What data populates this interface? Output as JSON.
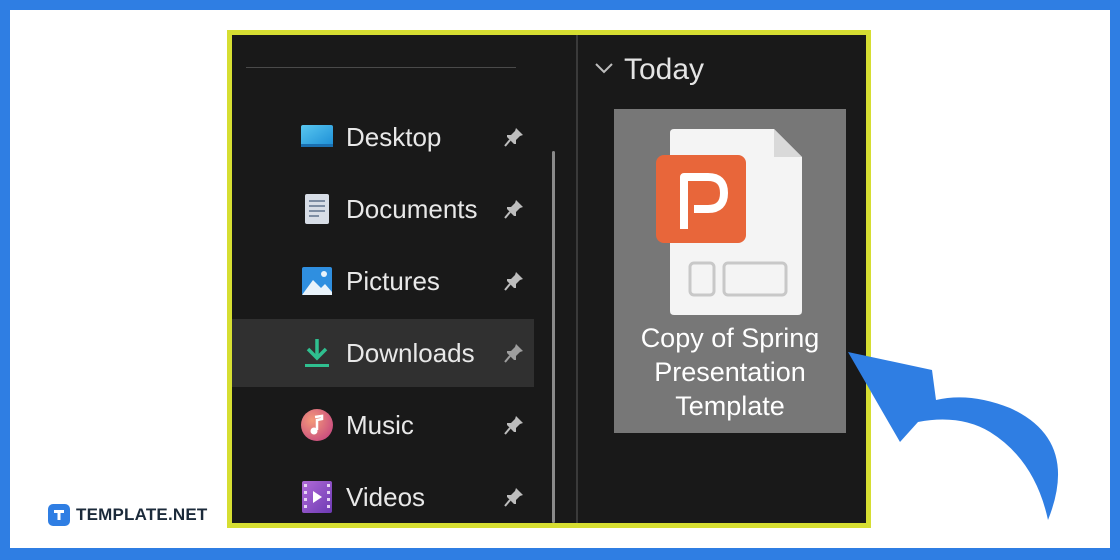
{
  "sidebar": {
    "items": [
      {
        "label": "Desktop",
        "icon": "desktop-icon",
        "pinned": true,
        "selected": false
      },
      {
        "label": "Documents",
        "icon": "documents-icon",
        "pinned": true,
        "selected": false
      },
      {
        "label": "Pictures",
        "icon": "pictures-icon",
        "pinned": true,
        "selected": false
      },
      {
        "label": "Downloads",
        "icon": "downloads-icon",
        "pinned": true,
        "selected": true
      },
      {
        "label": "Music",
        "icon": "music-icon",
        "pinned": true,
        "selected": false
      },
      {
        "label": "Videos",
        "icon": "videos-icon",
        "pinned": true,
        "selected": false
      }
    ]
  },
  "content": {
    "group_label": "Today",
    "file": {
      "name": "Copy of Spring Presentation Template",
      "name_lines": [
        "Copy of Spring",
        "Presentation",
        "Template"
      ],
      "icon": "powerpoint-file-icon",
      "selected": true
    }
  },
  "brand": {
    "text": "TEMPLATE.NET"
  },
  "colors": {
    "background_blue": "#2f7ee3",
    "frame_yellow": "#d6de32",
    "explorer_bg": "#191919",
    "selected_item_bg": "#303030",
    "file_tile_bg": "#777777",
    "powerpoint_orange": "#e8663a"
  }
}
